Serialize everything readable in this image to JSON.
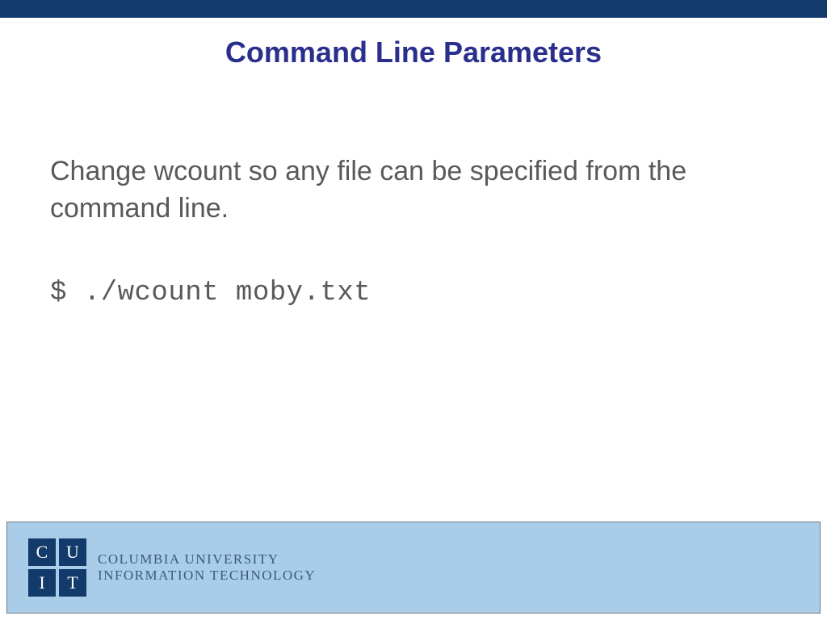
{
  "slide": {
    "title": "Command Line Parameters",
    "body_text": "Change wcount so any file can be specified from the command line.",
    "code_line": "$ ./wcount moby.txt"
  },
  "footer": {
    "logo_letters": [
      "C",
      "U",
      "I",
      "T"
    ],
    "org_line1": "COLUMBIA UNIVERSITY",
    "org_line2": "INFORMATION TECHNOLOGY"
  },
  "colors": {
    "top_bar": "#123a6b",
    "title": "#2b2f8c",
    "body": "#595959",
    "footer_bg": "#a9cce9"
  }
}
